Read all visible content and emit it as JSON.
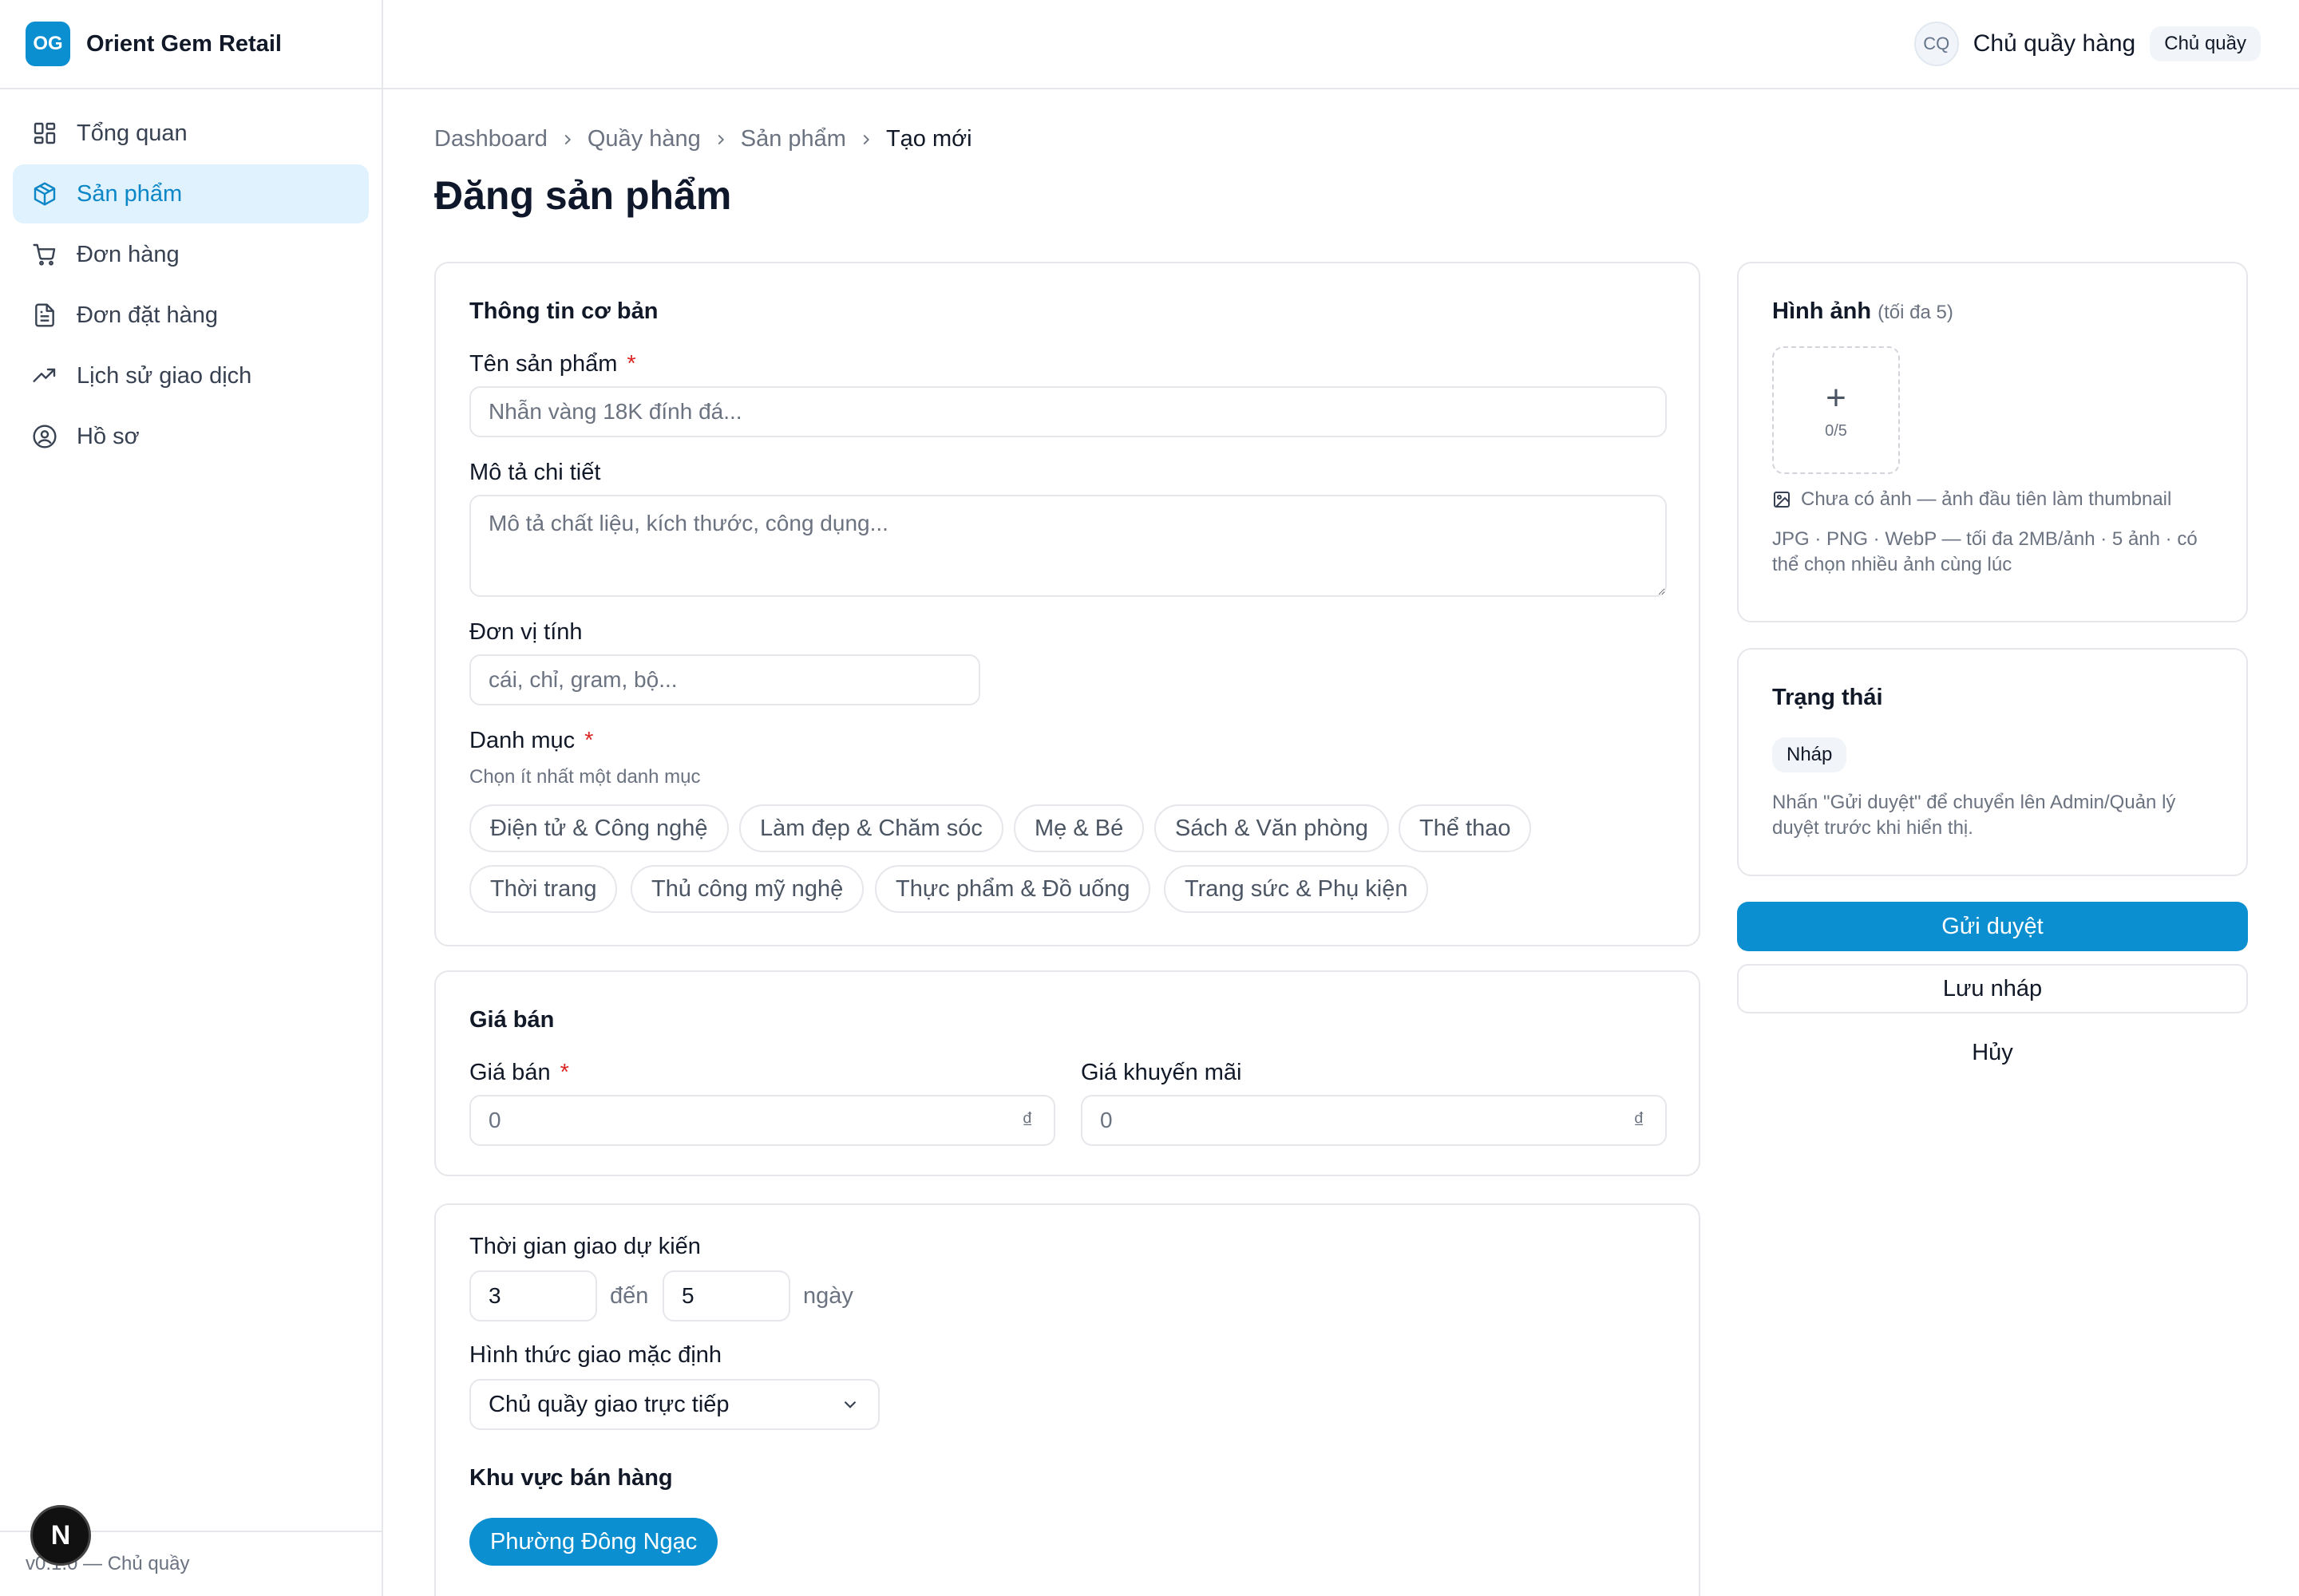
{
  "brand": {
    "logo": "OG",
    "name": "Orient Gem Retail"
  },
  "sidebar": {
    "items": [
      {
        "label": "Tổng quan",
        "icon": "dashboard-icon",
        "active": false
      },
      {
        "label": "Sản phẩm",
        "icon": "package-icon",
        "active": true
      },
      {
        "label": "Đơn hàng",
        "icon": "cart-icon",
        "active": false
      },
      {
        "label": "Đơn đặt hàng",
        "icon": "document-icon",
        "active": false
      },
      {
        "label": "Lịch sử giao dịch",
        "icon": "trending-icon",
        "active": false
      },
      {
        "label": "Hồ sơ",
        "icon": "user-circle-icon",
        "active": false
      }
    ],
    "footer": "v0.1.0 — Chủ quầy"
  },
  "header": {
    "avatar": "CQ",
    "user_name": "Chủ quầy hàng",
    "role": "Chủ quầy"
  },
  "breadcrumb": [
    "Dashboard",
    "Quầy hàng",
    "Sản phẩm",
    "Tạo mới"
  ],
  "page_title": "Đăng sản phẩm",
  "basic_info": {
    "title": "Thông tin cơ bản",
    "name_label": "Tên sản phẩm",
    "name_placeholder": "Nhẫn vàng 18K đính đá...",
    "desc_label": "Mô tả chi tiết",
    "desc_placeholder": "Mô tả chất liệu, kích thước, công dụng...",
    "unit_label": "Đơn vị tính",
    "unit_placeholder": "cái, chỉ, gram, bộ...",
    "category_label": "Danh mục",
    "category_hint": "Chọn ít nhất một danh mục",
    "categories": [
      "Điện tử & Công nghệ",
      "Làm đẹp & Chăm sóc",
      "Mẹ & Bé",
      "Sách & Văn phòng",
      "Thể thao",
      "Thời trang",
      "Thủ công mỹ nghệ",
      "Thực phẩm & Đồ uống",
      "Trang sức & Phụ kiện"
    ],
    "required_mark": "*"
  },
  "pricing": {
    "title": "Giá bán",
    "price_label": "Giá bán",
    "price_placeholder": "0",
    "promo_label": "Giá khuyến mãi",
    "promo_placeholder": "0",
    "currency": "₫"
  },
  "delivery": {
    "time_label": "Thời gian giao dự kiến",
    "from": "3",
    "to_word": "đến",
    "to": "5",
    "unit": "ngày",
    "method_label": "Hình thức giao mặc định",
    "method_value": "Chủ quầy giao trực tiếp",
    "region_label": "Khu vực bán hàng",
    "region_selected": "Phường Đông Ngạc"
  },
  "images": {
    "title": "Hình ảnh",
    "subtitle": "(tối đa 5)",
    "count": "0/5",
    "empty_text": "Chưa có ảnh — ảnh đầu tiên làm thumbnail",
    "formats_text": "JPG · PNG · WebP — tối đa 2MB/ảnh · 5 ảnh · có thể chọn nhiều ảnh cùng lúc"
  },
  "status": {
    "title": "Trạng thái",
    "badge": "Nháp",
    "description": "Nhấn \"Gửi duyệt\" để chuyển lên Admin/Quản lý duyệt trước khi hiển thị."
  },
  "actions": {
    "submit": "Gửi duyệt",
    "save_draft": "Lưu nháp",
    "cancel": "Hủy"
  },
  "colors": {
    "accent": "#0b8fd0",
    "active_bg": "#e0f2fe",
    "required": "#dc2626"
  }
}
